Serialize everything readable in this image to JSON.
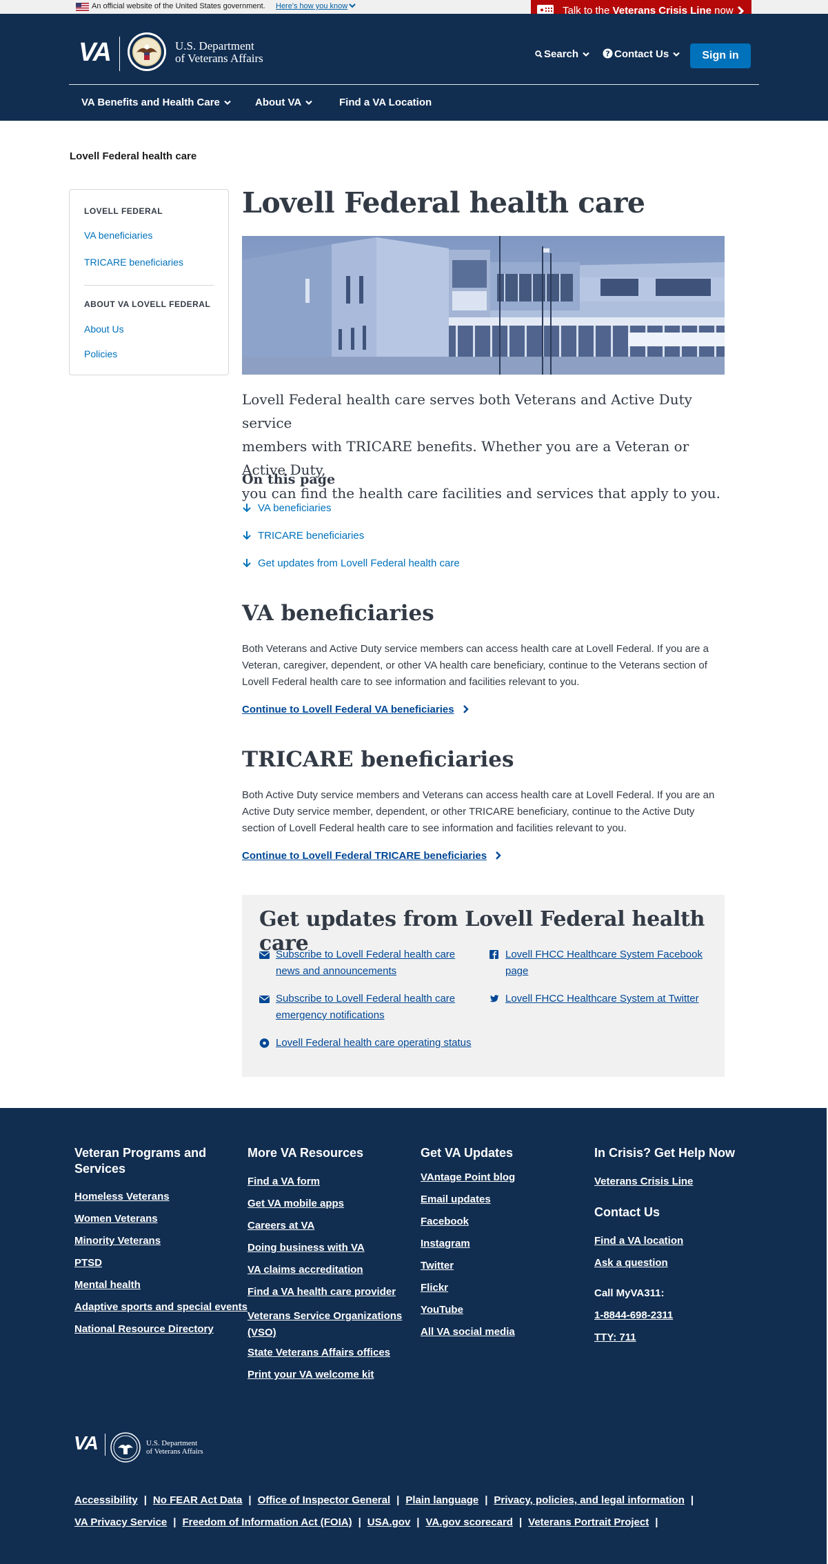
{
  "gov_banner": {
    "official_text": "An official website of the United States government.",
    "how_link": "Here's how you know"
  },
  "crisis": {
    "prefix": "Talk to the ",
    "bold": "Veterans Crisis Line",
    "suffix": " now"
  },
  "header": {
    "logo_short": "VA",
    "dept_line1": "U.S. Department",
    "dept_line2": "of Veterans Affairs",
    "search_label": "Search",
    "contact_label": "Contact Us",
    "signin_label": "Sign in",
    "nav": [
      "VA Benefits and Health Care",
      "About VA",
      "Find a VA Location"
    ]
  },
  "breadcrumb": "Lovell Federal health care",
  "sidenav": {
    "section1_title": "LOVELL FEDERAL",
    "section1_links": [
      "VA beneficiaries",
      "TRICARE beneficiaries"
    ],
    "section2_title": "ABOUT VA LOVELL FEDERAL",
    "section2_links": [
      "About Us",
      "Policies"
    ]
  },
  "main": {
    "title": "Lovell Federal health care",
    "intro_line1": "Lovell Federal health care serves both Veterans and Active Duty service",
    "intro_line2": "members with TRICARE benefits. Whether you are a Veteran or Active Duty,",
    "intro_line3": "you can find the health care facilities and services that apply to you.",
    "on_this_page": "On this page",
    "otp_links": [
      "VA beneficiaries",
      "TRICARE beneficiaries",
      "Get updates from Lovell Federal health care"
    ],
    "va_heading": "VA beneficiaries",
    "va_line1": "Both Veterans and Active Duty service members can access health care at Lovell Federal. If you are a",
    "va_line2": "Veteran, caregiver, dependent, or other VA health care beneficiary, continue to the Veterans section of",
    "va_line3": "Lovell Federal health care to see information and facilities relevant to you.",
    "va_continue": "Continue to Lovell Federal VA beneficiaries",
    "tricare_heading": "TRICARE beneficiaries",
    "tricare_line1": "Both Active Duty service members and Veterans can access health care at Lovell Federal. If you are an",
    "tricare_line2": "Active Duty service member, dependent, or other TRICARE beneficiary, continue to the Active Duty",
    "tricare_line3": "section of Lovell Federal health care to see information and facilities relevant to you.",
    "tricare_continue": "Continue to Lovell Federal TRICARE beneficiaries"
  },
  "updates": {
    "title": "Get updates from Lovell Federal health care",
    "subscribe_news_1": "Subscribe to Lovell Federal health care",
    "subscribe_news_2": "news and announcements",
    "subscribe_emerg_1": "Subscribe to Lovell Federal health care",
    "subscribe_emerg_2": "emergency notifications",
    "status": "Lovell Federal health care operating status",
    "facebook_1": "Lovell FHCC Healthcare System Facebook",
    "facebook_2": "page",
    "twitter": "Lovell FHCC Healthcare System at Twitter"
  },
  "footer": {
    "col1_title_1": "Veteran Programs and",
    "col1_title_2": "Services",
    "col1_links": [
      "Homeless Veterans",
      "Women Veterans",
      "Minority Veterans",
      "PTSD",
      "Mental health",
      "Adaptive sports and special events",
      "National Resource Directory"
    ],
    "col2_title": "More VA Resources",
    "col2_links": [
      "Find a VA form",
      "Get VA mobile apps",
      "Careers at VA",
      "Doing business with VA",
      "VA claims accreditation",
      "Find a VA health care provider",
      "Veterans Service Organizations",
      "(VSO)",
      "State Veterans Affairs offices",
      "Print your VA welcome kit"
    ],
    "col3_title": "Get VA Updates",
    "col3_links": [
      "VAntage Point blog",
      "Email updates",
      "Facebook",
      "Instagram",
      "Twitter",
      "Flickr",
      "YouTube",
      "All VA social media"
    ],
    "col4_title": "In Crisis? Get Help Now",
    "crisis_link": "Veterans Crisis Line",
    "contact_title": "Contact Us",
    "contact_links": [
      "Find a VA location",
      "Ask a question"
    ],
    "call_label": "Call MyVA311:",
    "phone": "1-8844-698-2311",
    "tty": "TTY: 711",
    "logo_short": "VA",
    "dept_line1": "U.S. Department",
    "dept_line2": "of Veterans Affairs",
    "legal_row1": [
      "Accessibility",
      "No FEAR Act Data",
      "Office of Inspector General",
      "Plain language",
      "Privacy, policies, and legal information"
    ],
    "legal_row2": [
      "VA Privacy Service",
      "Freedom of Information Act (FOIA)",
      "USA.gov",
      "VA.gov scorecard",
      "Veterans Portrait Project"
    ]
  },
  "colors": {
    "header_bg": "#112e51",
    "crisis_red": "#b50909",
    "signin_blue": "#0071bb",
    "link_blue": "#004795"
  }
}
